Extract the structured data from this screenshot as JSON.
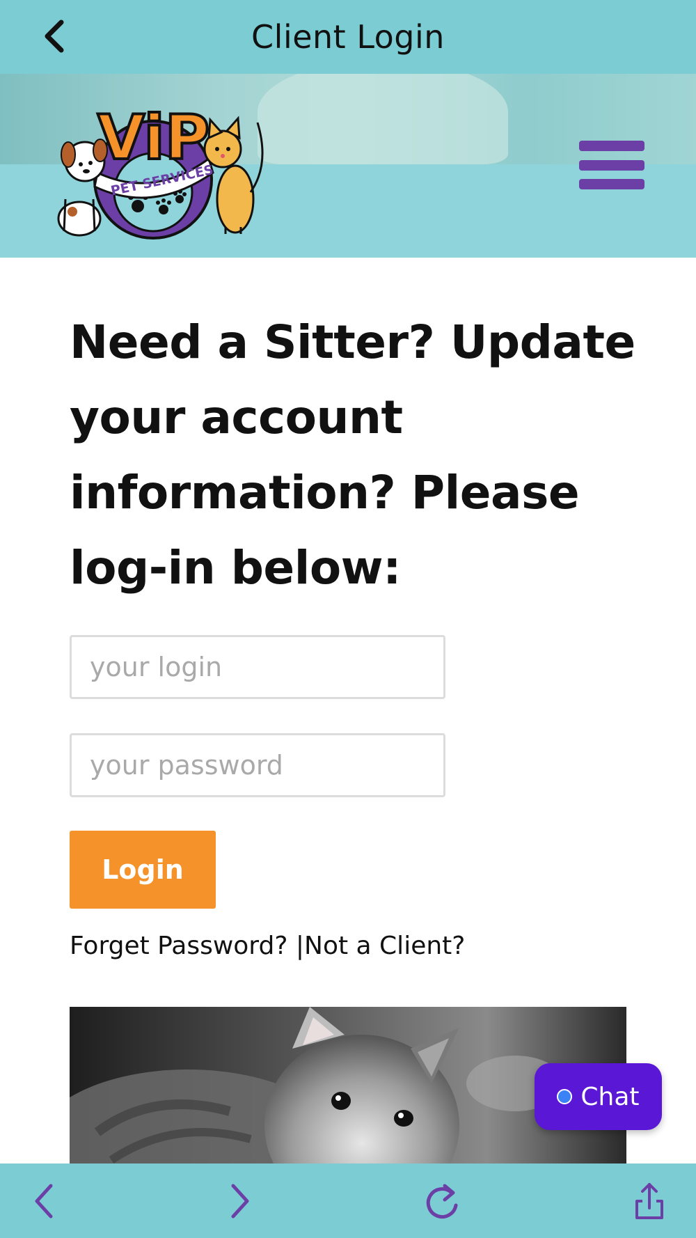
{
  "topbar": {
    "title": "Client Login",
    "back_icon": "chevron-left-icon"
  },
  "header": {
    "logo_alt": "VIP PET SERVICES",
    "logo_text_main": "ViP",
    "logo_text_sub": "PET SERVICES",
    "menu_icon": "hamburger-menu-icon"
  },
  "main": {
    "heading": "Need a Sitter? Update your account information? Please log-in below:",
    "login_placeholder": "your login",
    "password_placeholder": "your password",
    "login_button": "Login",
    "forgot_password": "Forget Password?",
    "separator": "|",
    "not_client": "Not a Client?"
  },
  "chat": {
    "label": "Chat"
  },
  "colors": {
    "bar": "#7ccdd3",
    "accent_purple": "#6b3fa6",
    "login_orange": "#f6922a",
    "chat_purple": "#5a17d6"
  },
  "bottombar": {
    "back_icon": "chevron-left-icon",
    "forward_icon": "chevron-right-icon",
    "reload_icon": "reload-icon",
    "share_icon": "share-icon"
  }
}
